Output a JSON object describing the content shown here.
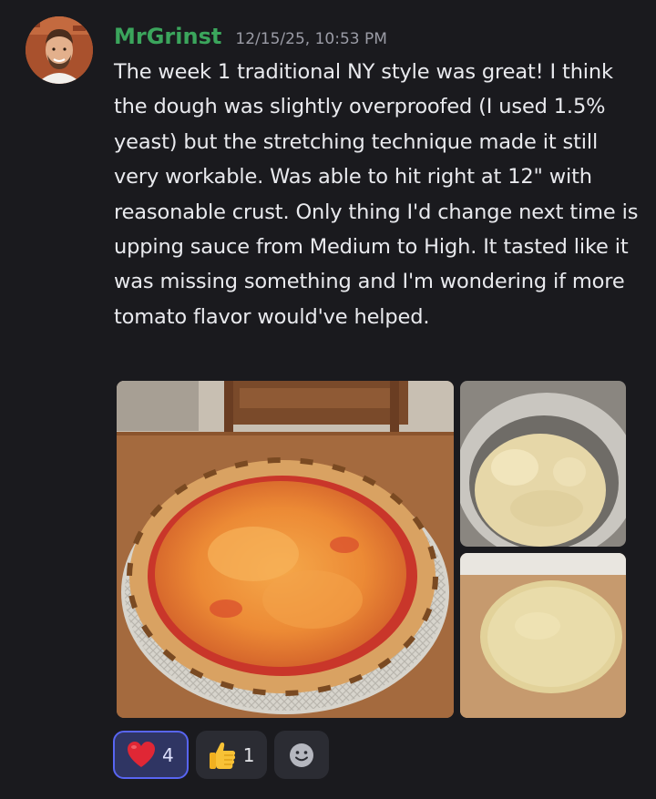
{
  "message": {
    "username": "MrGrinst",
    "timestamp": "12/15/25, 10:53 PM",
    "text": "The week 1 traditional NY style was great! I think the dough was slightly overproofed (I used 1.5% yeast) but the stretching technique made it still very workable. Was able to hit right at 12\" with reasonable crust. Only thing I'd change next time is upping sauce from Medium to High. It tasted like it was missing something and I'm wondering if more tomato flavor would've helped."
  },
  "attachments": [
    {
      "subject": "pizza-photo",
      "icon": "pizza"
    },
    {
      "subject": "dough-ball-in-bowl",
      "icon": "dough"
    },
    {
      "subject": "stretched-dough",
      "icon": "dough"
    }
  ],
  "reactions": [
    {
      "emoji": "red-heart",
      "count": "4",
      "reacted": true
    },
    {
      "emoji": "thumbs-up",
      "count": "1",
      "reacted": false
    }
  ],
  "add_reaction": {
    "icon": "smiley-face-icon"
  },
  "colors": {
    "background": "#1a1a1e",
    "username": "#3ba55c",
    "timestamp": "#9b9ca6",
    "reaction_active_border": "#5865f2"
  }
}
